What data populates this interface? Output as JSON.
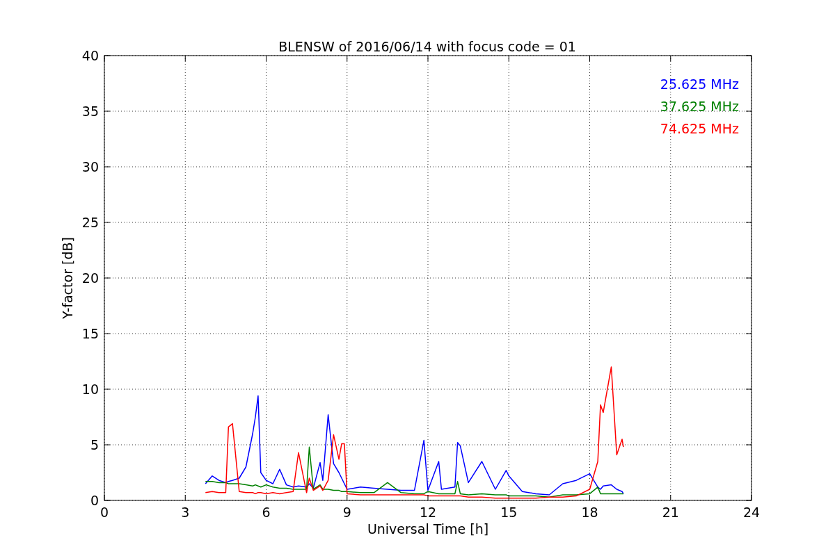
{
  "chart_data": {
    "type": "line",
    "title": "BLENSW of 2016/06/14 with focus code = 01",
    "xlabel": "Universal Time [h]",
    "ylabel": "Y-factor [dB]",
    "xlim": [
      0,
      24
    ],
    "ylim": [
      0,
      40
    ],
    "xticks": [
      0,
      3,
      6,
      9,
      12,
      15,
      18,
      21,
      24
    ],
    "yticks": [
      0,
      5,
      10,
      15,
      20,
      25,
      30,
      35,
      40
    ],
    "grid": true,
    "x": [
      3.75,
      4,
      4.25,
      4.5,
      4.6,
      4.75,
      5,
      5.25,
      5.5,
      5.6,
      5.7,
      5.8,
      6,
      6.25,
      6.5,
      6.75,
      7,
      7.2,
      7.5,
      7.6,
      7.75,
      8,
      8.1,
      8.3,
      8.5,
      8.7,
      8.8,
      8.9,
      9,
      9.5,
      10,
      10.5,
      11,
      11.5,
      11.85,
      12,
      12.4,
      12.5,
      13,
      13.1,
      13.2,
      13.5,
      14,
      14.5,
      14.9,
      15,
      15.5,
      16,
      16.5,
      17,
      17.5,
      18,
      18.3,
      18.4,
      18.5,
      18.8,
      19,
      19.2,
      19.25
    ],
    "series": [
      {
        "name": "25.625 MHz",
        "color": "#0000ff",
        "values": [
          1.5,
          2.2,
          1.8,
          1.6,
          1.7,
          1.8,
          2.0,
          3.0,
          6.0,
          7.5,
          9.4,
          2.5,
          1.8,
          1.5,
          2.8,
          1.4,
          1.2,
          1.3,
          1.2,
          1.5,
          1.1,
          3.4,
          1.8,
          7.7,
          3.3,
          2.5,
          2.0,
          1.5,
          1.0,
          1.2,
          1.1,
          1.0,
          0.9,
          0.9,
          5.4,
          0.9,
          3.5,
          1.0,
          1.2,
          5.2,
          4.9,
          1.6,
          3.5,
          1.0,
          2.7,
          2.2,
          0.8,
          0.6,
          0.5,
          1.5,
          1.8,
          2.4,
          1.2,
          1.0,
          1.3,
          1.4,
          1.0,
          0.8,
          0.6
        ]
      },
      {
        "name": "37.625 MHz",
        "color": "#008000",
        "values": [
          1.7,
          1.7,
          1.6,
          1.6,
          1.5,
          1.5,
          1.5,
          1.4,
          1.3,
          1.4,
          1.3,
          1.2,
          1.4,
          1.2,
          1.1,
          1.1,
          1.0,
          1.0,
          1.0,
          4.8,
          1.0,
          1.4,
          1.0,
          1.0,
          0.9,
          0.9,
          0.8,
          0.8,
          0.8,
          0.7,
          0.7,
          1.6,
          0.7,
          0.6,
          0.6,
          0.8,
          0.6,
          0.6,
          0.6,
          1.7,
          0.6,
          0.5,
          0.6,
          0.5,
          0.5,
          0.4,
          0.4,
          0.4,
          0.3,
          0.5,
          0.5,
          0.6,
          1.2,
          0.6,
          0.6,
          0.6,
          0.6,
          0.6,
          0.6
        ]
      },
      {
        "name": "74.625 MHz",
        "color": "#ff0000",
        "values": [
          0.7,
          0.8,
          0.7,
          0.7,
          6.6,
          6.9,
          0.8,
          0.7,
          0.7,
          0.6,
          0.7,
          0.7,
          0.6,
          0.7,
          0.6,
          0.7,
          0.8,
          4.3,
          0.7,
          2.0,
          0.9,
          1.3,
          0.9,
          1.8,
          5.9,
          3.7,
          5.1,
          5.1,
          0.6,
          0.5,
          0.5,
          0.5,
          0.5,
          0.5,
          0.5,
          0.4,
          0.4,
          0.4,
          0.4,
          0.4,
          0.4,
          0.3,
          0.3,
          0.2,
          0.2,
          0.2,
          0.2,
          0.2,
          0.3,
          0.3,
          0.4,
          1.0,
          3.5,
          8.6,
          7.9,
          12.0,
          4.1,
          5.5,
          4.8
        ]
      }
    ]
  }
}
